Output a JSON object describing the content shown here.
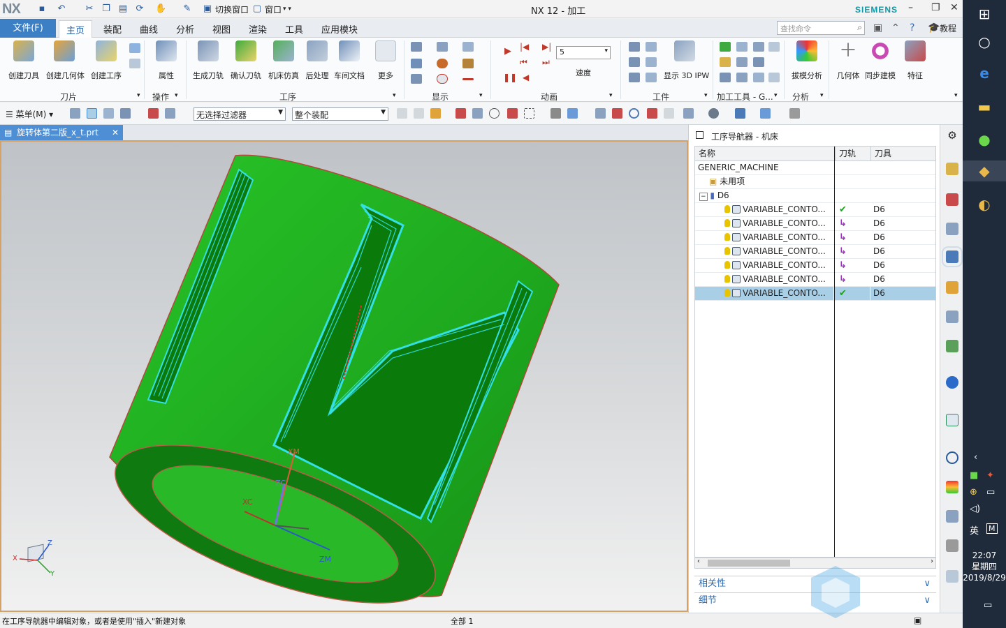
{
  "app": {
    "logo": "NX",
    "title": "NX 12 - 加工",
    "brand": "SIEMENS"
  },
  "quick_access": {
    "switch_window": "切换窗口",
    "window": "窗口"
  },
  "tabs": {
    "file": "文件(F)",
    "items": [
      "主页",
      "装配",
      "曲线",
      "分析",
      "视图",
      "渲染",
      "工具",
      "应用模块"
    ],
    "active": "主页"
  },
  "search": {
    "placeholder": "查找命令"
  },
  "tutorial": "教程",
  "ribbon": {
    "buttons": [
      "创建刀具",
      "创建几何体",
      "创建工序",
      "属性",
      "生成刀轨",
      "确认刀轨",
      "机床仿真",
      "后处理",
      "车间文档",
      "更多",
      "显示 3D IPW",
      "拔模分析",
      "几何体",
      "同步建模",
      "特征"
    ],
    "groups": [
      "刀片",
      "操作",
      "工序",
      "显示",
      "动画",
      "工件",
      "加工工具 - G...",
      "分析"
    ],
    "speed_value": "5",
    "speed_label": "速度"
  },
  "toolbar2": {
    "menu": "菜单(M)",
    "filter": "无选择过滤器",
    "scope": "整个装配"
  },
  "document": {
    "tab": "旋转体第二版_x_t.prt"
  },
  "viewport": {
    "axes": {
      "xm": "XM",
      "zc": "ZC",
      "xc": "XC",
      "zm": "ZM"
    },
    "triad": {
      "z": "Z",
      "x": "X",
      "y": "Y"
    }
  },
  "navigator": {
    "title": "工序导航器 - 机床",
    "columns": [
      "名称",
      "刀轨",
      "刀具"
    ],
    "root": "GENERIC_MACHINE",
    "unused": "未用项",
    "tool_node": "D6",
    "rows": [
      {
        "name": "VARIABLE_CONTO...",
        "path": "✔",
        "path_state": "ok",
        "tool": "D6"
      },
      {
        "name": "VARIABLE_CONTO...",
        "path": "↳",
        "path_state": "regen",
        "tool": "D6"
      },
      {
        "name": "VARIABLE_CONTO...",
        "path": "↳",
        "path_state": "regen",
        "tool": "D6"
      },
      {
        "name": "VARIABLE_CONTO...",
        "path": "↳",
        "path_state": "regen",
        "tool": "D6"
      },
      {
        "name": "VARIABLE_CONTO...",
        "path": "↳",
        "path_state": "regen",
        "tool": "D6"
      },
      {
        "name": "VARIABLE_CONTO...",
        "path": "↳",
        "path_state": "regen",
        "tool": "D6"
      },
      {
        "name": "VARIABLE_CONTO...",
        "path": "✔",
        "path_state": "ok",
        "tool": "D6"
      }
    ],
    "selected_row": 6,
    "panels": [
      "相关性",
      "细节"
    ]
  },
  "status": {
    "message": "在工序导航器中编辑对象，或者是使用\"插入\"新建对象",
    "selection": "全部 1"
  },
  "taskbar": {
    "time": "22:07",
    "weekday": "星期四",
    "date": "2019/8/29",
    "ime": "英",
    "ime2": "M"
  },
  "colors": {
    "accent": "#3c7fc4",
    "part_green": "#1fb21f",
    "toolpath": "#33e0e6",
    "selection": "#a9cfe7"
  }
}
